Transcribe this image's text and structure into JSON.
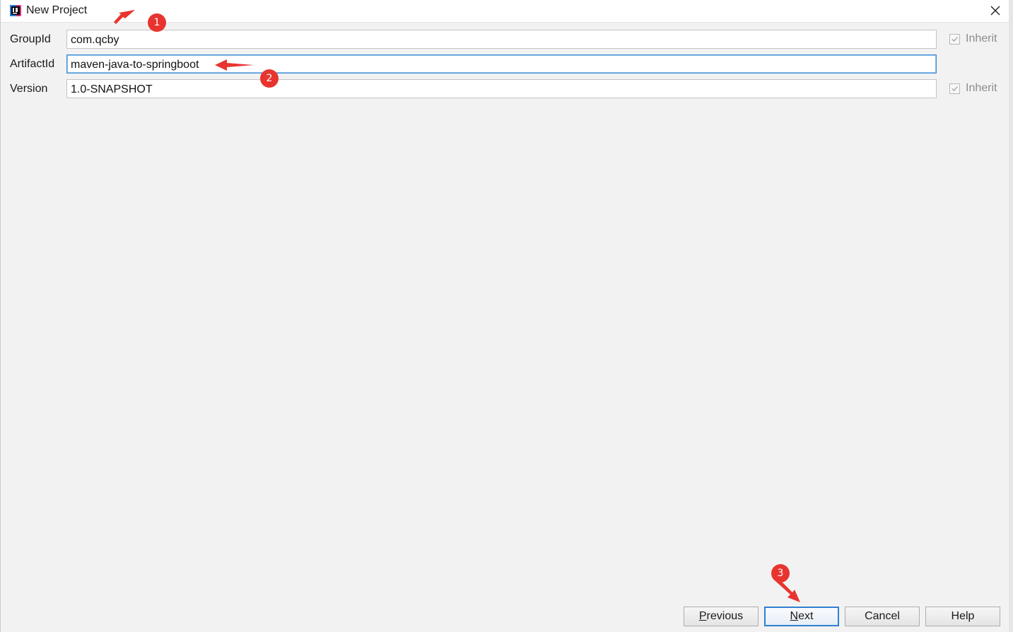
{
  "window": {
    "title": "New Project",
    "app_icon": "intellij-idea-icon",
    "close_icon": "close-icon"
  },
  "fields": [
    {
      "label": "GroupId",
      "value": "com.qcby",
      "inherit_label": "Inherit",
      "inherit_checked": true
    },
    {
      "label": "ArtifactId",
      "value": "maven-java-to-springboot"
    },
    {
      "label": "Version",
      "value": "1.0-SNAPSHOT",
      "inherit_label": "Inherit",
      "inherit_checked": true
    }
  ],
  "buttons": {
    "previous": {
      "mnemonic": "P",
      "rest": "revious"
    },
    "next": {
      "mnemonic": "N",
      "rest": "ext"
    },
    "cancel": "Cancel",
    "help": "Help"
  },
  "annotations": [
    {
      "label": "1"
    },
    {
      "label": "2"
    },
    {
      "label": "3"
    }
  ],
  "colors": {
    "annotation_red": "#e8342f",
    "focus_blue": "#3d8ed8",
    "default_button_border": "#2f7fd2",
    "dialog_background": "#f2f2f2"
  }
}
